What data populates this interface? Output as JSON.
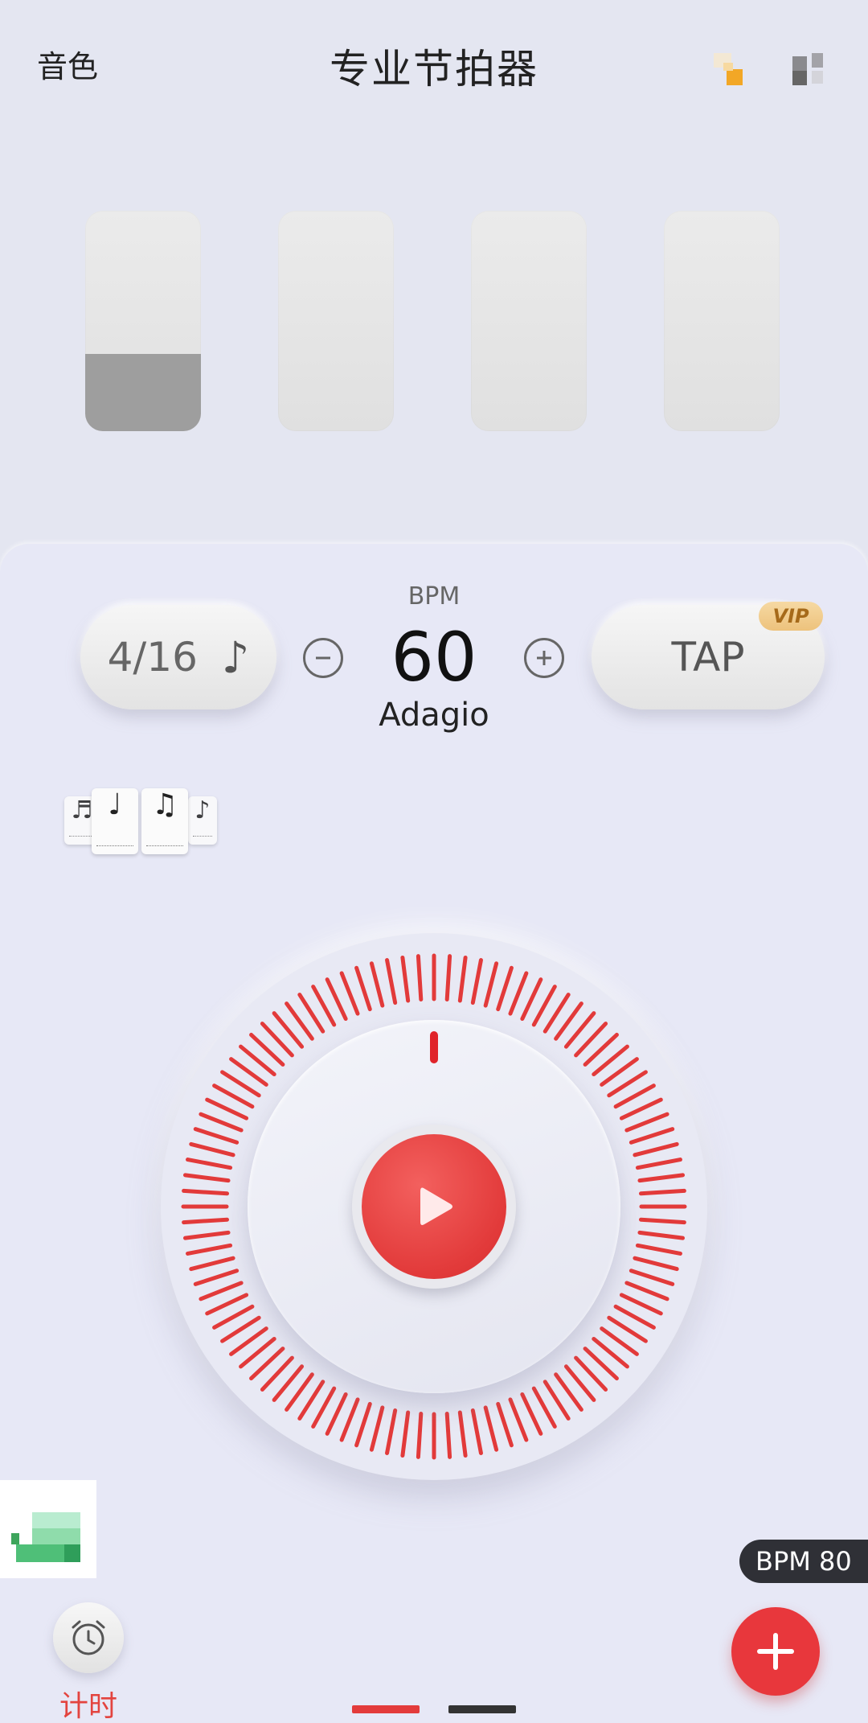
{
  "header": {
    "timbre_label": "音色",
    "title": "专业节拍器"
  },
  "beats": [
    {
      "index": 1,
      "level": 0.35
    },
    {
      "index": 2,
      "level": 0
    },
    {
      "index": 3,
      "level": 0
    },
    {
      "index": 4,
      "level": 0
    }
  ],
  "controls": {
    "time_signature": "4/16",
    "note_symbol": "♪",
    "bpm_label": "BPM",
    "bpm_value": "60",
    "tempo_name": "Adagio",
    "tap_label": "TAP",
    "vip_label": "VIP",
    "minus_symbol": "−",
    "plus_symbol": "+"
  },
  "rhythm_cards": [
    {
      "symbol": "♬"
    },
    {
      "symbol": "♩"
    },
    {
      "symbol": "♫"
    },
    {
      "symbol": "♪"
    }
  ],
  "player": {
    "state": "paused",
    "accent_color": "#e23a3a"
  },
  "footer": {
    "timer_label": "计时",
    "bpm_tag": "BPM 80"
  },
  "pager": {
    "pages": 2,
    "current": 1
  }
}
